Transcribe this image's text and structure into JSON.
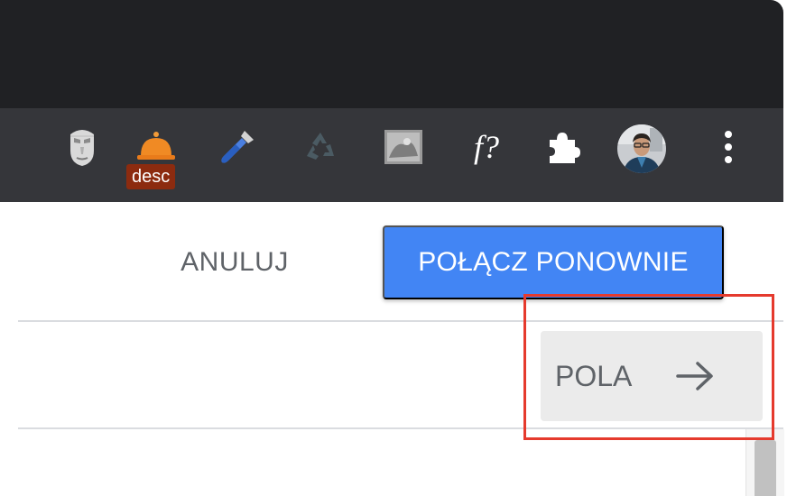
{
  "browser": {
    "extensions": [
      {
        "name": "face-mask-extension",
        "icon": "face-mask-icon"
      },
      {
        "name": "desc-extension",
        "icon": "bell-icon",
        "badge": "desc"
      },
      {
        "name": "color-picker-extension",
        "icon": "eyedropper-icon"
      },
      {
        "name": "recycle-extension",
        "icon": "recycle-icon"
      },
      {
        "name": "image-extension",
        "icon": "photo-thumbnail-icon"
      },
      {
        "name": "formula-extension",
        "icon": "fq-icon",
        "label": "f?"
      },
      {
        "name": "extensions-menu",
        "icon": "puzzle-icon"
      },
      {
        "name": "profile",
        "icon": "avatar-icon"
      },
      {
        "name": "browser-menu",
        "icon": "kebab-menu-icon"
      }
    ]
  },
  "dialog": {
    "cancel_label": "ANULUJ",
    "reconnect_label": "POŁĄCZ PONOWNIE"
  },
  "fields": {
    "label": "POLA",
    "icon": "arrow-right-icon"
  },
  "colors": {
    "titlebar": "#202124",
    "toolbar": "#35363a",
    "primary": "#4285f4",
    "highlight": "#e53a2d",
    "badge": "#8c2b0f"
  }
}
